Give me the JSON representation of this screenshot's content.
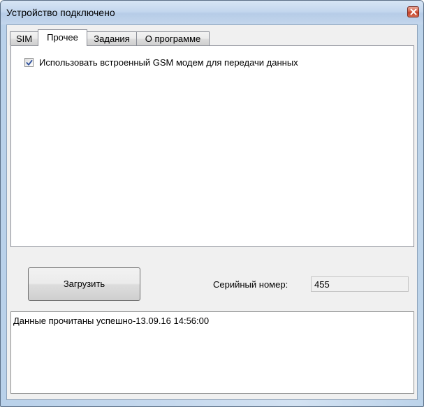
{
  "window": {
    "title": "Устройство подключено"
  },
  "tabs": [
    {
      "label": "SIM",
      "selected": false
    },
    {
      "label": "Прочее",
      "selected": true
    },
    {
      "label": "Задания",
      "selected": false
    },
    {
      "label": "О программе",
      "selected": false
    }
  ],
  "other_tab": {
    "use_gsm_label": "Использовать встроенный GSM модем для передачи данных",
    "use_gsm_checked": true
  },
  "actions": {
    "load_label": "Загрузить"
  },
  "serial": {
    "label": "Серийный номер:",
    "value": "455"
  },
  "log": {
    "text": "Данные прочитаны успешно-13.09.16 14:56:00"
  },
  "icons": {
    "close": "close-icon",
    "check": "checkmark-icon"
  },
  "colors": {
    "title_bar": "#c4d7ee",
    "close_button": "#c2402a",
    "panel_bg": "#f0f0f0",
    "checkmark": "#2a4d9b"
  }
}
